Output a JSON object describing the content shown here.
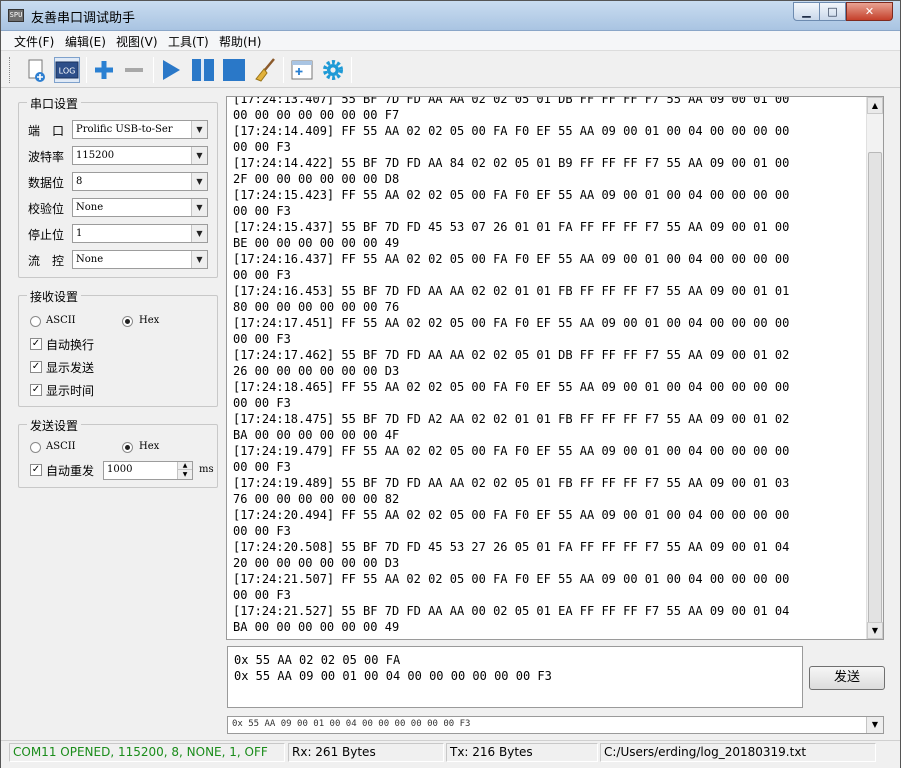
{
  "window": {
    "title": "友善串口调试助手",
    "icon_label": "SPU",
    "min_icon": "minimize-icon",
    "max_icon": "maximize-icon",
    "close_icon": "close-icon"
  },
  "menu": [
    {
      "label": "文件(F)"
    },
    {
      "label": "编辑(E)"
    },
    {
      "label": "视图(V)"
    },
    {
      "label": "工具(T)"
    },
    {
      "label": "帮助(H)"
    }
  ],
  "toolbar": {
    "log_label": "LOG",
    "icons": [
      "new-page-icon",
      "log-icon",
      "add-icon",
      "remove-icon",
      "play-icon",
      "pause-icon",
      "stop-icon",
      "broom-icon",
      "add-window-icon",
      "gear-icon"
    ]
  },
  "serial_settings": {
    "title": "串口设置",
    "port_label": "端　口",
    "port_value": "Prolific USB-to-Ser",
    "baud_label": "波特率",
    "baud_value": "115200",
    "databits_label": "数据位",
    "databits_value": "8",
    "parity_label": "校验位",
    "parity_value": "None",
    "stopbits_label": "停止位",
    "stopbits_value": "1",
    "flow_label": "流　控",
    "flow_value": "None"
  },
  "receive_settings": {
    "title": "接收设置",
    "ascii_label": "ASCII",
    "hex_label": "Hex",
    "selected": "Hex",
    "auto_newline_label": "自动换行",
    "show_send_label": "显示发送",
    "show_time_label": "显示时间",
    "auto_newline": true,
    "show_send": true,
    "show_time": true
  },
  "send_settings": {
    "title": "发送设置",
    "ascii_label": "ASCII",
    "hex_label": "Hex",
    "selected": "Hex",
    "auto_resend_label": "自动重发",
    "auto_resend": true,
    "interval_value": "1000",
    "interval_unit": "ms"
  },
  "receive_log": "[17:24:13.407] 55 BF 7D FD AA AA 02 02 05 01 DB FF FF FF F7 55 AA 09 00 01 00\n00 00 00 00 00 00 00 F7\n[17:24:14.409] FF 55 AA 02 02 05 00 FA F0 EF 55 AA 09 00 01 00 04 00 00 00 00\n00 00 F3\n[17:24:14.422] 55 BF 7D FD AA 84 02 02 05 01 B9 FF FF FF F7 55 AA 09 00 01 00\n2F 00 00 00 00 00 00 D8\n[17:24:15.423] FF 55 AA 02 02 05 00 FA F0 EF 55 AA 09 00 01 00 04 00 00 00 00\n00 00 F3\n[17:24:15.437] 55 BF 7D FD 45 53 07 26 01 01 FA FF FF FF F7 55 AA 09 00 01 00\nBE 00 00 00 00 00 00 49\n[17:24:16.437] FF 55 AA 02 02 05 00 FA F0 EF 55 AA 09 00 01 00 04 00 00 00 00\n00 00 F3\n[17:24:16.453] 55 BF 7D FD AA AA 02 02 01 01 FB FF FF FF F7 55 AA 09 00 01 01\n80 00 00 00 00 00 00 76\n[17:24:17.451] FF 55 AA 02 02 05 00 FA F0 EF 55 AA 09 00 01 00 04 00 00 00 00\n00 00 F3\n[17:24:17.462] 55 BF 7D FD AA AA 02 02 05 01 DB FF FF FF F7 55 AA 09 00 01 02\n26 00 00 00 00 00 00 D3\n[17:24:18.465] FF 55 AA 02 02 05 00 FA F0 EF 55 AA 09 00 01 00 04 00 00 00 00\n00 00 F3\n[17:24:18.475] 55 BF 7D FD A2 AA 02 02 01 01 FB FF FF FF F7 55 AA 09 00 01 02\nBA 00 00 00 00 00 00 4F\n[17:24:19.479] FF 55 AA 02 02 05 00 FA F0 EF 55 AA 09 00 01 00 04 00 00 00 00\n00 00 F3\n[17:24:19.489] 55 BF 7D FD AA AA 02 02 05 01 FB FF FF FF F7 55 AA 09 00 01 03\n76 00 00 00 00 00 00 82\n[17:24:20.494] FF 55 AA 02 02 05 00 FA F0 EF 55 AA 09 00 01 00 04 00 00 00 00\n00 00 F3\n[17:24:20.508] 55 BF 7D FD 45 53 27 26 05 01 FA FF FF FF F7 55 AA 09 00 01 04\n20 00 00 00 00 00 00 D3\n[17:24:21.507] FF 55 AA 02 02 05 00 FA F0 EF 55 AA 09 00 01 00 04 00 00 00 00\n00 00 F3\n[17:24:21.527] 55 BF 7D FD AA AA 00 02 05 01 EA FF FF FF F7 55 AA 09 00 01 04\nBA 00 00 00 00 00 00 49",
  "send_text": "0x 55 AA 02 02 05 00 FA\n0x 55 AA 09 00 01 00 04 00 00 00 00 00 00 F3",
  "send_button": "发送",
  "history_text": "0x 55 AA 02 02 05 00 FA\n0x 55 AA 09 00 01 00 04 00 00 00 00 00 00 F3",
  "status": {
    "connection": "COM11 OPENED, 115200, 8, NONE, 1, OFF",
    "connection_color": "#1a8c1a",
    "rx": "Rx: 261 Bytes",
    "tx": "Tx: 216 Bytes",
    "log_path": "C:/Users/erding/log_20180319.txt"
  }
}
